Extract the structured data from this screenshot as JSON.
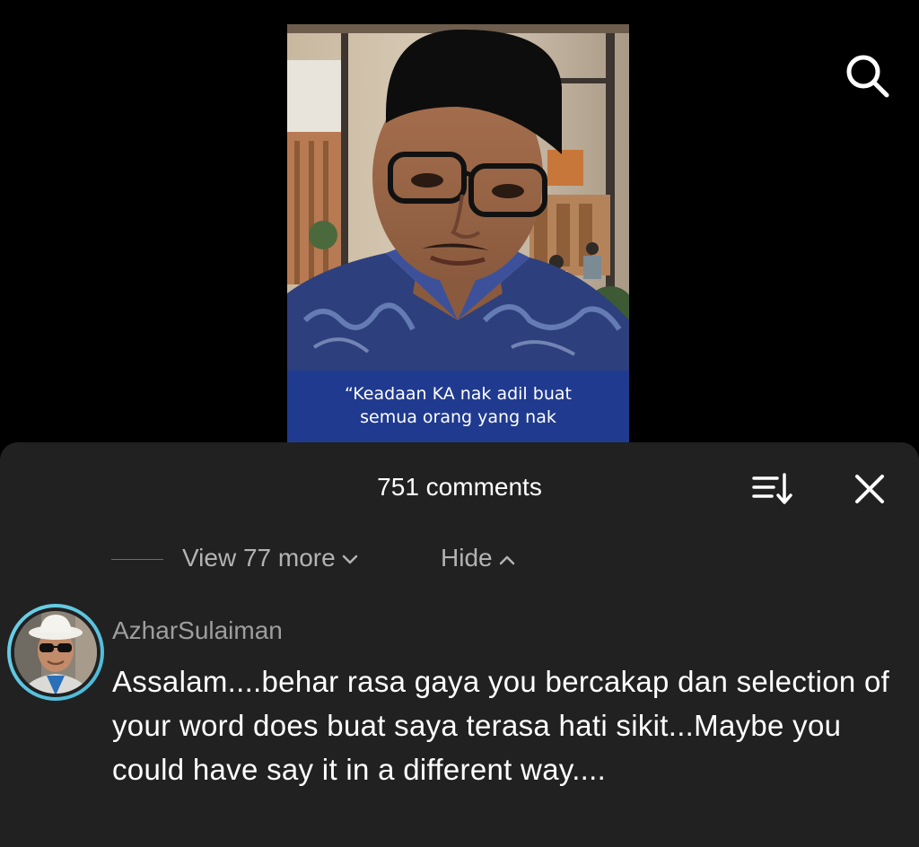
{
  "video": {
    "caption_line1": "“Keadaan KA nak adil buat",
    "caption_line2": "semua orang yang nak"
  },
  "comments_sheet": {
    "count_label": "751 comments",
    "view_more_label": "View 77 more",
    "hide_label": "Hide"
  },
  "comment": {
    "username": "AzharSulaiman",
    "text": "Assalam....behar rasa gaya you bercakap dan selection of your word does buat saya terasa hati sikit...Maybe you could have say it in a different way...."
  },
  "icons": {
    "search": "search-icon",
    "sort": "sort-icon",
    "close": "close-icon",
    "view_more_chevron": "chevron-down-icon",
    "hide_chevron": "chevron-up-icon"
  },
  "colors": {
    "background": "#000000",
    "sheet": "#212121",
    "caption_band": "#1f3a8f",
    "avatar_ring": "#5ec8e0"
  }
}
